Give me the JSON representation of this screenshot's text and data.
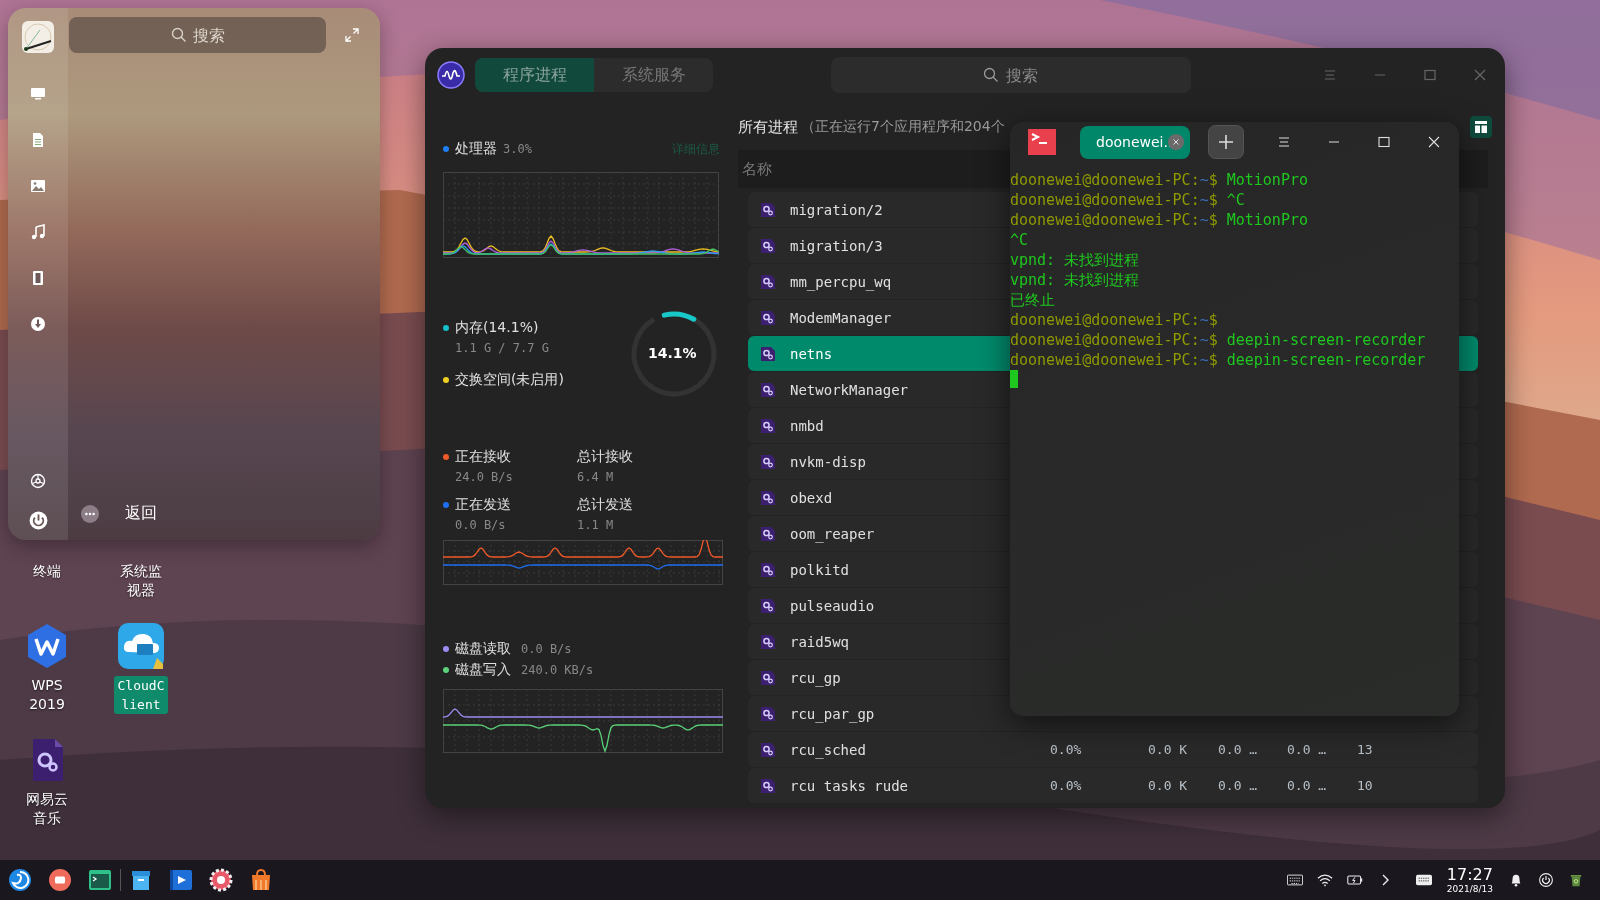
{
  "launcher": {
    "search": {
      "placeholder": "搜索"
    },
    "back": "返回"
  },
  "desktop_icons": [
    {
      "label": "终端",
      "kind": "covered",
      "selected": false
    },
    {
      "label": "系统监视器",
      "kind": "covered",
      "selected": false
    },
    {
      "label": "WPS 2019",
      "kind": "wps",
      "selected": false
    },
    {
      "label": "CloudClient",
      "kind": "cloud",
      "selected": true
    },
    {
      "label": "网易云音乐",
      "kind": "app",
      "selected": false
    }
  ],
  "sysmon": {
    "tabs": [
      {
        "label": "程序进程",
        "selected": true
      },
      {
        "label": "系统服务",
        "selected": false
      }
    ],
    "search": {
      "placeholder": "搜索"
    },
    "cpu": {
      "label": "处理器",
      "value": "3.0%",
      "details": "详细信息"
    },
    "memory": {
      "label": "内存(14.1%)",
      "usage": "1.1 G / 7.7 G",
      "swap": "交换空间(未启用)",
      "ring_text": "14.1%",
      "level": 0.141
    },
    "network": [
      {
        "label": "正在接收",
        "value": "24.0 B/s",
        "total_label": "总计接收",
        "total": "6.4 M",
        "color": "#f05a28"
      },
      {
        "label": "正在发送",
        "value": "0.0 B/s",
        "total_label": "总计发送",
        "total": "1.1 M",
        "color": "#1e6ff0"
      }
    ],
    "disk": [
      {
        "label": "磁盘读取",
        "value": "0.0 B/s",
        "color": "#9b8cf0"
      },
      {
        "label": "磁盘写入",
        "value": "240.0 KB/s",
        "color": "#5bd27a"
      }
    ],
    "processes": {
      "title": "所有进程",
      "summary": "（正在运行7个应用程序和204个",
      "columns": [
        "名称"
      ],
      "rows": [
        {
          "name": "migration/2",
          "selected": false
        },
        {
          "name": "migration/3",
          "selected": false
        },
        {
          "name": "mm_percpu_wq",
          "selected": false
        },
        {
          "name": "ModemManager",
          "selected": false
        },
        {
          "name": "netns",
          "selected": true
        },
        {
          "name": "NetworkManager",
          "selected": false
        },
        {
          "name": "nmbd",
          "selected": false
        },
        {
          "name": "nvkm-disp",
          "selected": false
        },
        {
          "name": "obexd",
          "selected": false
        },
        {
          "name": "oom_reaper",
          "selected": false
        },
        {
          "name": "polkitd",
          "selected": false
        },
        {
          "name": "pulseaudio",
          "selected": false
        },
        {
          "name": "raid5wq",
          "selected": false
        },
        {
          "name": "rcu_gp",
          "selected": false
        },
        {
          "name": "rcu_par_gp",
          "selected": false
        },
        {
          "name": "rcu_sched",
          "selected": false,
          "cells": [
            "0.0%",
            "0.0 K",
            "0.0 …",
            "0.0 …",
            "13"
          ]
        },
        {
          "name": "rcu tasks rude",
          "selected": false,
          "cells": [
            "0.0%",
            "0.0 K",
            "0.0 …",
            "0.0 …",
            "10"
          ]
        }
      ]
    }
  },
  "terminal": {
    "tab": "doonewei..",
    "lines": [
      {
        "kind": "prompt",
        "user": "doonewei@doonewei-PC",
        "sep": ":",
        "path": "~",
        "sigil": "$",
        "command": "MotionPro"
      },
      {
        "kind": "prompt",
        "user": "doonewei@doonewei-PC",
        "sep": ":",
        "path": "~",
        "sigil": "$",
        "command": "^C"
      },
      {
        "kind": "prompt",
        "user": "doonewei@doonewei-PC",
        "sep": ":",
        "path": "~",
        "sigil": "$",
        "command": "MotionPro"
      },
      {
        "kind": "output",
        "text": "^C"
      },
      {
        "kind": "output",
        "text": "vpnd: 未找到进程"
      },
      {
        "kind": "output",
        "text": "vpnd: 未找到进程"
      },
      {
        "kind": "output",
        "text": "已终止"
      },
      {
        "kind": "prompt",
        "user": "doonewei@doonewei-PC",
        "sep": ":",
        "path": "~",
        "sigil": "$"
      },
      {
        "kind": "prompt",
        "user": "doonewei@doonewei-PC",
        "sep": ":",
        "path": "~",
        "sigil": "$",
        "command": "deepin-screen-recorder"
      },
      {
        "kind": "prompt",
        "user": "doonewei@doonewei-PC",
        "sep": ":",
        "path": "~",
        "sigil": "$",
        "command": "deepin-screen-recorder"
      }
    ]
  },
  "taskbar": {
    "time": "17:27",
    "date": "2021/8/13"
  }
}
